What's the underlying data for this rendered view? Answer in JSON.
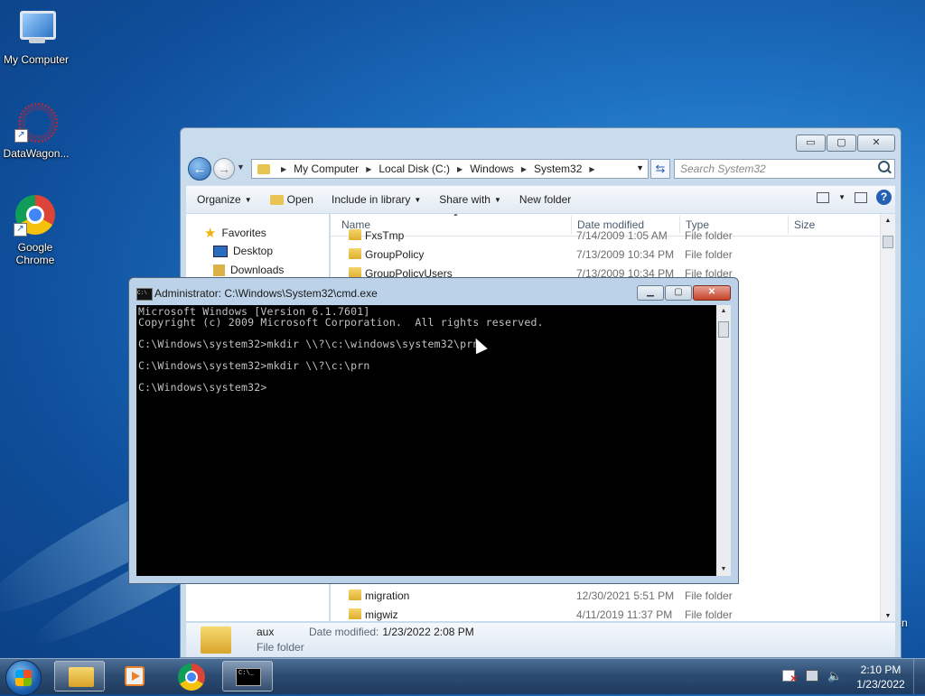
{
  "desktop": {
    "icons": [
      {
        "label": "My Computer"
      },
      {
        "label": "DataWagon..."
      },
      {
        "label": "Google Chrome"
      }
    ],
    "edge_text": "n"
  },
  "explorer": {
    "window_buttons": {
      "minimize": "▭",
      "maximize": "▢",
      "close": "✕"
    },
    "address": {
      "crumbs": [
        "My Computer",
        "Local Disk (C:)",
        "Windows",
        "System32"
      ],
      "search_placeholder": "Search System32"
    },
    "toolbar": {
      "organize": "Organize",
      "open": "Open",
      "include_in_library": "Include in library",
      "share_with": "Share with",
      "new_folder": "New folder"
    },
    "nav": {
      "favorites": "Favorites",
      "desktop": "Desktop",
      "downloads": "Downloads"
    },
    "columns": {
      "name": "Name",
      "date": "Date modified",
      "type": "Type",
      "size": "Size"
    },
    "rows": [
      {
        "name": "FxsTmp",
        "date": "7/14/2009 1:05 AM",
        "type": "File folder"
      },
      {
        "name": "GroupPolicy",
        "date": "7/13/2009 10:34 PM",
        "type": "File folder"
      },
      {
        "name": "GroupPolicyUsers",
        "date": "7/13/2009 10:34 PM",
        "type": "File folder"
      },
      {
        "name": "migration",
        "date": "12/30/2021 5:51 PM",
        "type": "File folder"
      },
      {
        "name": "migwiz",
        "date": "4/11/2019 11:37 PM",
        "type": "File folder"
      }
    ],
    "details": {
      "name": "aux",
      "type": "File folder",
      "modified_label": "Date modified:",
      "modified_value": "1/23/2022 2:08 PM"
    }
  },
  "cmd": {
    "title": "Administrator: C:\\Windows\\System32\\cmd.exe",
    "icon_text": "C:\\",
    "buttons": {
      "minimize": "▁",
      "maximize": "▢",
      "close": "✕"
    },
    "lines": [
      "Microsoft Windows [Version 6.1.7601]",
      "Copyright (c) 2009 Microsoft Corporation.  All rights reserved.",
      "",
      "C:\\Windows\\system32>mkdir \\\\?\\c:\\windows\\system32\\prn",
      "",
      "C:\\Windows\\system32>mkdir \\\\?\\c:\\prn",
      "",
      "C:\\Windows\\system32>"
    ]
  },
  "taskbar": {
    "cmd_icon_text": "C:\\_",
    "clock_time": "2:10 PM",
    "clock_date": "1/23/2022"
  }
}
